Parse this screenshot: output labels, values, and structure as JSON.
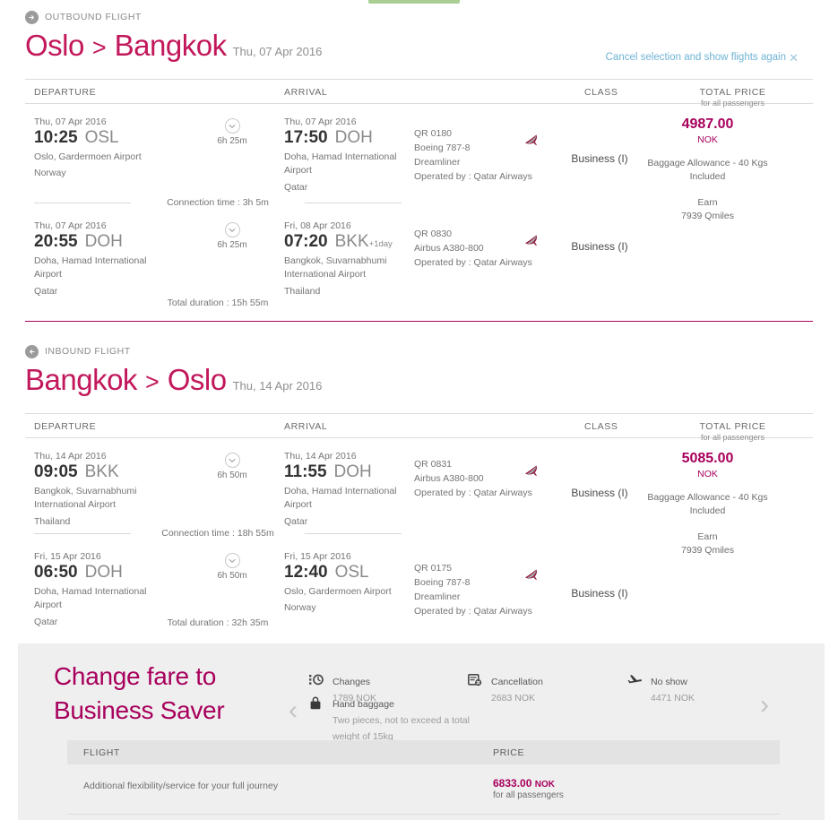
{
  "journeys": [
    {
      "badge_label": "OUTBOUND FLIGHT",
      "badge_icon": "arrow-right-circle-icon",
      "origin": "Oslo",
      "separator": ">",
      "destination": "Bangkok",
      "date": "Thu, 07 Apr 2016",
      "cancel_link": "Cancel selection and show flights again",
      "cancel_icon": "close-icon",
      "columns": {
        "departure": "DEPARTURE",
        "arrival": "ARRIVAL",
        "class": "CLASS",
        "price": "TOTAL PRICE",
        "price_sub": "for all passengers"
      },
      "segments": [
        {
          "depart_date": "Thu, 07 Apr 2016",
          "depart_time": "10:25",
          "depart_code": "OSL",
          "depart_airport": "Oslo, Gardermoen Airport",
          "depart_country": "Norway",
          "duration": "6h 25m",
          "arrive_date": "Thu, 07 Apr 2016",
          "arrive_time": "17:50",
          "arrive_code": "DOH",
          "arrive_plus_day": "",
          "arrive_airport": "Doha, Hamad International Airport",
          "arrive_country": "Qatar",
          "flight_number": "QR 0180",
          "aircraft": "Boeing 787-8",
          "aircraft_name": "Dreamliner",
          "operated_by": "Operated by : Qatar Airways",
          "cabin": "Business (I)"
        },
        {
          "depart_date": "Thu, 07 Apr 2016",
          "depart_time": "20:55",
          "depart_code": "DOH",
          "depart_airport": "Doha, Hamad International Airport",
          "depart_country": "Qatar",
          "duration": "6h 25m",
          "arrive_date": "Fri, 08 Apr 2016",
          "arrive_time": "07:20",
          "arrive_code": "BKK",
          "arrive_plus_day": "+1day",
          "arrive_airport": "Bangkok, Suvarnabhumi International Airport",
          "arrive_country": "Thailand",
          "flight_number": "QR 0830",
          "aircraft": "Airbus A380-800",
          "aircraft_name": "",
          "operated_by": "Operated by : Qatar Airways",
          "cabin": "Business (I)"
        }
      ],
      "connection_time": "Connection time : 3h 5m",
      "total_duration": "Total duration : 15h 55m",
      "price_amount": "4987.00",
      "price_currency": "NOK",
      "baggage_line1": "Baggage Allowance - 40 Kgs",
      "baggage_line2": "Included",
      "earn_line1": "Earn",
      "earn_line2": "7939 Qmiles"
    },
    {
      "badge_label": "INBOUND FLIGHT",
      "badge_icon": "arrow-left-circle-icon",
      "origin": "Bangkok",
      "separator": ">",
      "destination": "Oslo",
      "date": "Thu, 14 Apr 2016",
      "cancel_link": "",
      "cancel_icon": "",
      "columns": {
        "departure": "DEPARTURE",
        "arrival": "ARRIVAL",
        "class": "CLASS",
        "price": "TOTAL PRICE",
        "price_sub": "for all passengers"
      },
      "segments": [
        {
          "depart_date": "Thu, 14 Apr 2016",
          "depart_time": "09:05",
          "depart_code": "BKK",
          "depart_airport": "Bangkok, Suvarnabhumi International Airport",
          "depart_country": "Thailand",
          "duration": "6h 50m",
          "arrive_date": "Thu, 14 Apr 2016",
          "arrive_time": "11:55",
          "arrive_code": "DOH",
          "arrive_plus_day": "",
          "arrive_airport": "Doha, Hamad International Airport",
          "arrive_country": "Qatar",
          "flight_number": "QR 0831",
          "aircraft": "Airbus A380-800",
          "aircraft_name": "",
          "operated_by": "Operated by : Qatar Airways",
          "cabin": "Business (I)"
        },
        {
          "depart_date": "Fri, 15 Apr 2016",
          "depart_time": "06:50",
          "depart_code": "DOH",
          "depart_airport": "Doha, Hamad International Airport",
          "depart_country": "Qatar",
          "duration": "6h 50m",
          "arrive_date": "Fri, 15 Apr 2016",
          "arrive_time": "12:40",
          "arrive_code": "OSL",
          "arrive_plus_day": "",
          "arrive_airport": "Oslo, Gardermoen Airport",
          "arrive_country": "Norway",
          "flight_number": "QR 0175",
          "aircraft": "Boeing 787-8",
          "aircraft_name": "Dreamliner",
          "operated_by": "Operated by : Qatar Airways",
          "cabin": "Business (I)"
        }
      ],
      "connection_time": "Connection time : 18h 55m",
      "total_duration": "Total duration : 32h 35m",
      "price_amount": "5085.00",
      "price_currency": "NOK",
      "baggage_line1": "Baggage Allowance - 40 Kgs",
      "baggage_line2": "Included",
      "earn_line1": "Earn",
      "earn_line2": "7939 Qmiles"
    }
  ],
  "fare_panel": {
    "title_line1": "Change fare to",
    "title_line2": "Business Saver",
    "prev_arrow": "‹",
    "next_arrow": "›",
    "benefits": [
      {
        "icon": "changes-clock-icon",
        "title": "Changes",
        "sub": "1789 NOK"
      },
      {
        "icon": "cancellation-icon",
        "title": "Cancellation",
        "sub": "2683 NOK"
      },
      {
        "icon": "no-show-plane-icon",
        "title": "No show",
        "sub": "4471 NOK"
      },
      {
        "icon": "hand-baggage-icon",
        "title": "Hand baggage",
        "sub": "Two pieces, not to exceed a total weight of 15kg"
      }
    ],
    "table": {
      "col_flight": "FLIGHT",
      "col_price": "PRICE",
      "row_description": "Additional flexibility/service for your full journey",
      "row_amount": "6833.00",
      "row_currency": "NOK",
      "row_sub": "for all passengers"
    }
  },
  "colors": {
    "brand_magenta": "#a8005c",
    "route_pink": "#c2185b",
    "link_blue": "#6fb3d4",
    "panel_grey": "#efefef",
    "top_green": "#a9cf94"
  }
}
